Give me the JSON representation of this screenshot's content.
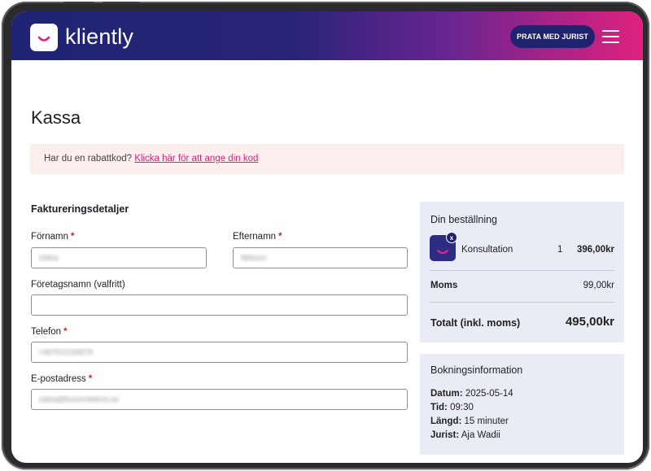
{
  "header": {
    "brand": "kliently",
    "cta_label": "PRATA MED JURIST",
    "menu_icon": "hamburger-menu-icon",
    "logo_icon": "smile-logo-icon",
    "colors": {
      "gradient_start": "#1f2473",
      "gradient_end": "#e0217f",
      "cta_bg": "#1f226e"
    }
  },
  "page": {
    "title": "Kassa",
    "coupon": {
      "prompt": "Har du en rabattkod?",
      "link": "Klicka här för att ange din kod",
      "colors": {
        "background": "#fdeeee",
        "link": "#d4237f"
      }
    }
  },
  "billing": {
    "title": "Faktureringsdetaljer",
    "fields": {
      "first_name": {
        "label": "Förnamn",
        "required": "*",
        "value": "Odea"
      },
      "last_name": {
        "label": "Efternamn",
        "required": "*",
        "value": "Nilsson"
      },
      "company": {
        "label": "Företagsnamn (valfritt)",
        "value": ""
      },
      "phone": {
        "label": "Telefon",
        "required": "*",
        "value": "+46701234878"
      },
      "email": {
        "label": "E-postadress",
        "required": "*",
        "value": "odea@kunomkilent.se"
      }
    }
  },
  "order": {
    "title": "Din beställning",
    "item": {
      "name": "Konsultation",
      "qty": "1",
      "price": "396,00kr",
      "remove_label": "x"
    },
    "vat_label": "Moms",
    "vat_value": "99,00kr",
    "total_label": "Totalt (inkl. moms)",
    "total_value": "495,00kr"
  },
  "booking": {
    "title": "Bokningsinformation",
    "date_label": "Datum:",
    "date_value": "2025-05-14",
    "time_label": "Tid:",
    "time_value": "09:30",
    "length_label": "Längd:",
    "length_value": "15 minuter",
    "lawyer_label": "Jurist:",
    "lawyer_value": "Aja Wadii"
  }
}
